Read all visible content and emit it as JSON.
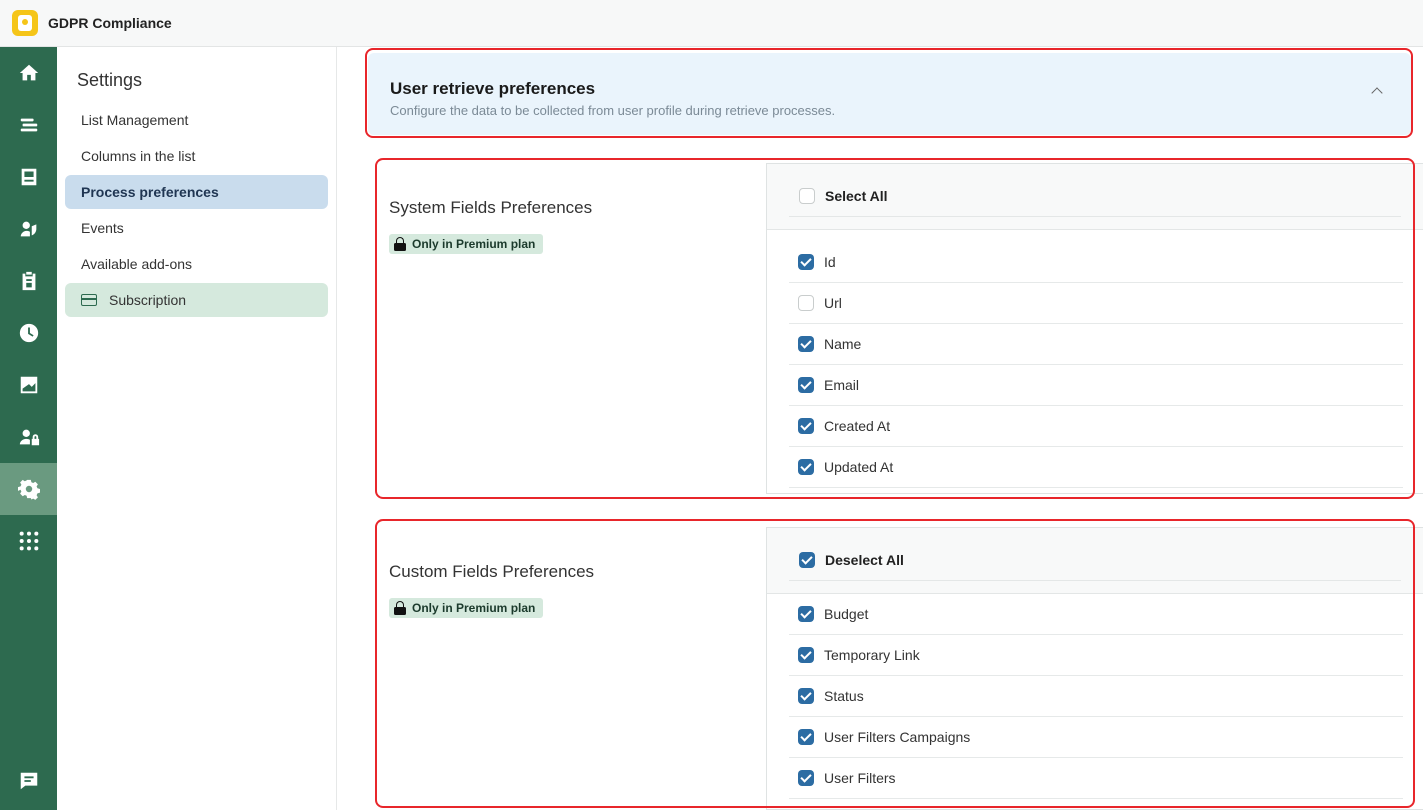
{
  "app": {
    "title": "GDPR Compliance"
  },
  "rail": {
    "items": [
      {
        "icon": "home-icon"
      },
      {
        "icon": "list-icon"
      },
      {
        "icon": "inbox-icon"
      },
      {
        "icon": "shield-user-icon"
      },
      {
        "icon": "clipboard-icon"
      },
      {
        "icon": "clock-icon"
      },
      {
        "icon": "chart-icon"
      },
      {
        "icon": "user-lock-icon"
      },
      {
        "icon": "gear-icon",
        "active": true
      },
      {
        "icon": "apps-grid-icon"
      },
      {
        "icon": "chat-icon"
      }
    ]
  },
  "settings": {
    "title": "Settings",
    "items": [
      {
        "label": "List Management"
      },
      {
        "label": "Columns in the list"
      },
      {
        "label": "Process preferences",
        "active": true
      },
      {
        "label": "Events"
      },
      {
        "label": "Available add-ons"
      },
      {
        "label": "Subscription"
      }
    ]
  },
  "header": {
    "title": "User retrieve preferences",
    "subtitle": "Configure the data to be collected from user profile during retrieve processes."
  },
  "system_fields": {
    "title": "System Fields Preferences",
    "badge": "Only in Premium plan",
    "select_label": "Select All",
    "select_checked": false,
    "fields": [
      {
        "label": "Id",
        "checked": true
      },
      {
        "label": "Url",
        "checked": false
      },
      {
        "label": "Name",
        "checked": true
      },
      {
        "label": "Email",
        "checked": true
      },
      {
        "label": "Created At",
        "checked": true
      },
      {
        "label": "Updated At",
        "checked": true
      }
    ]
  },
  "custom_fields": {
    "title": "Custom Fields Preferences",
    "badge": "Only in Premium plan",
    "select_label": "Deselect All",
    "select_checked": true,
    "fields": [
      {
        "label": "Budget",
        "checked": true
      },
      {
        "label": "Temporary Link",
        "checked": true
      },
      {
        "label": "Status",
        "checked": true
      },
      {
        "label": "User Filters Campaigns",
        "checked": true
      },
      {
        "label": "User Filters",
        "checked": true
      }
    ]
  }
}
